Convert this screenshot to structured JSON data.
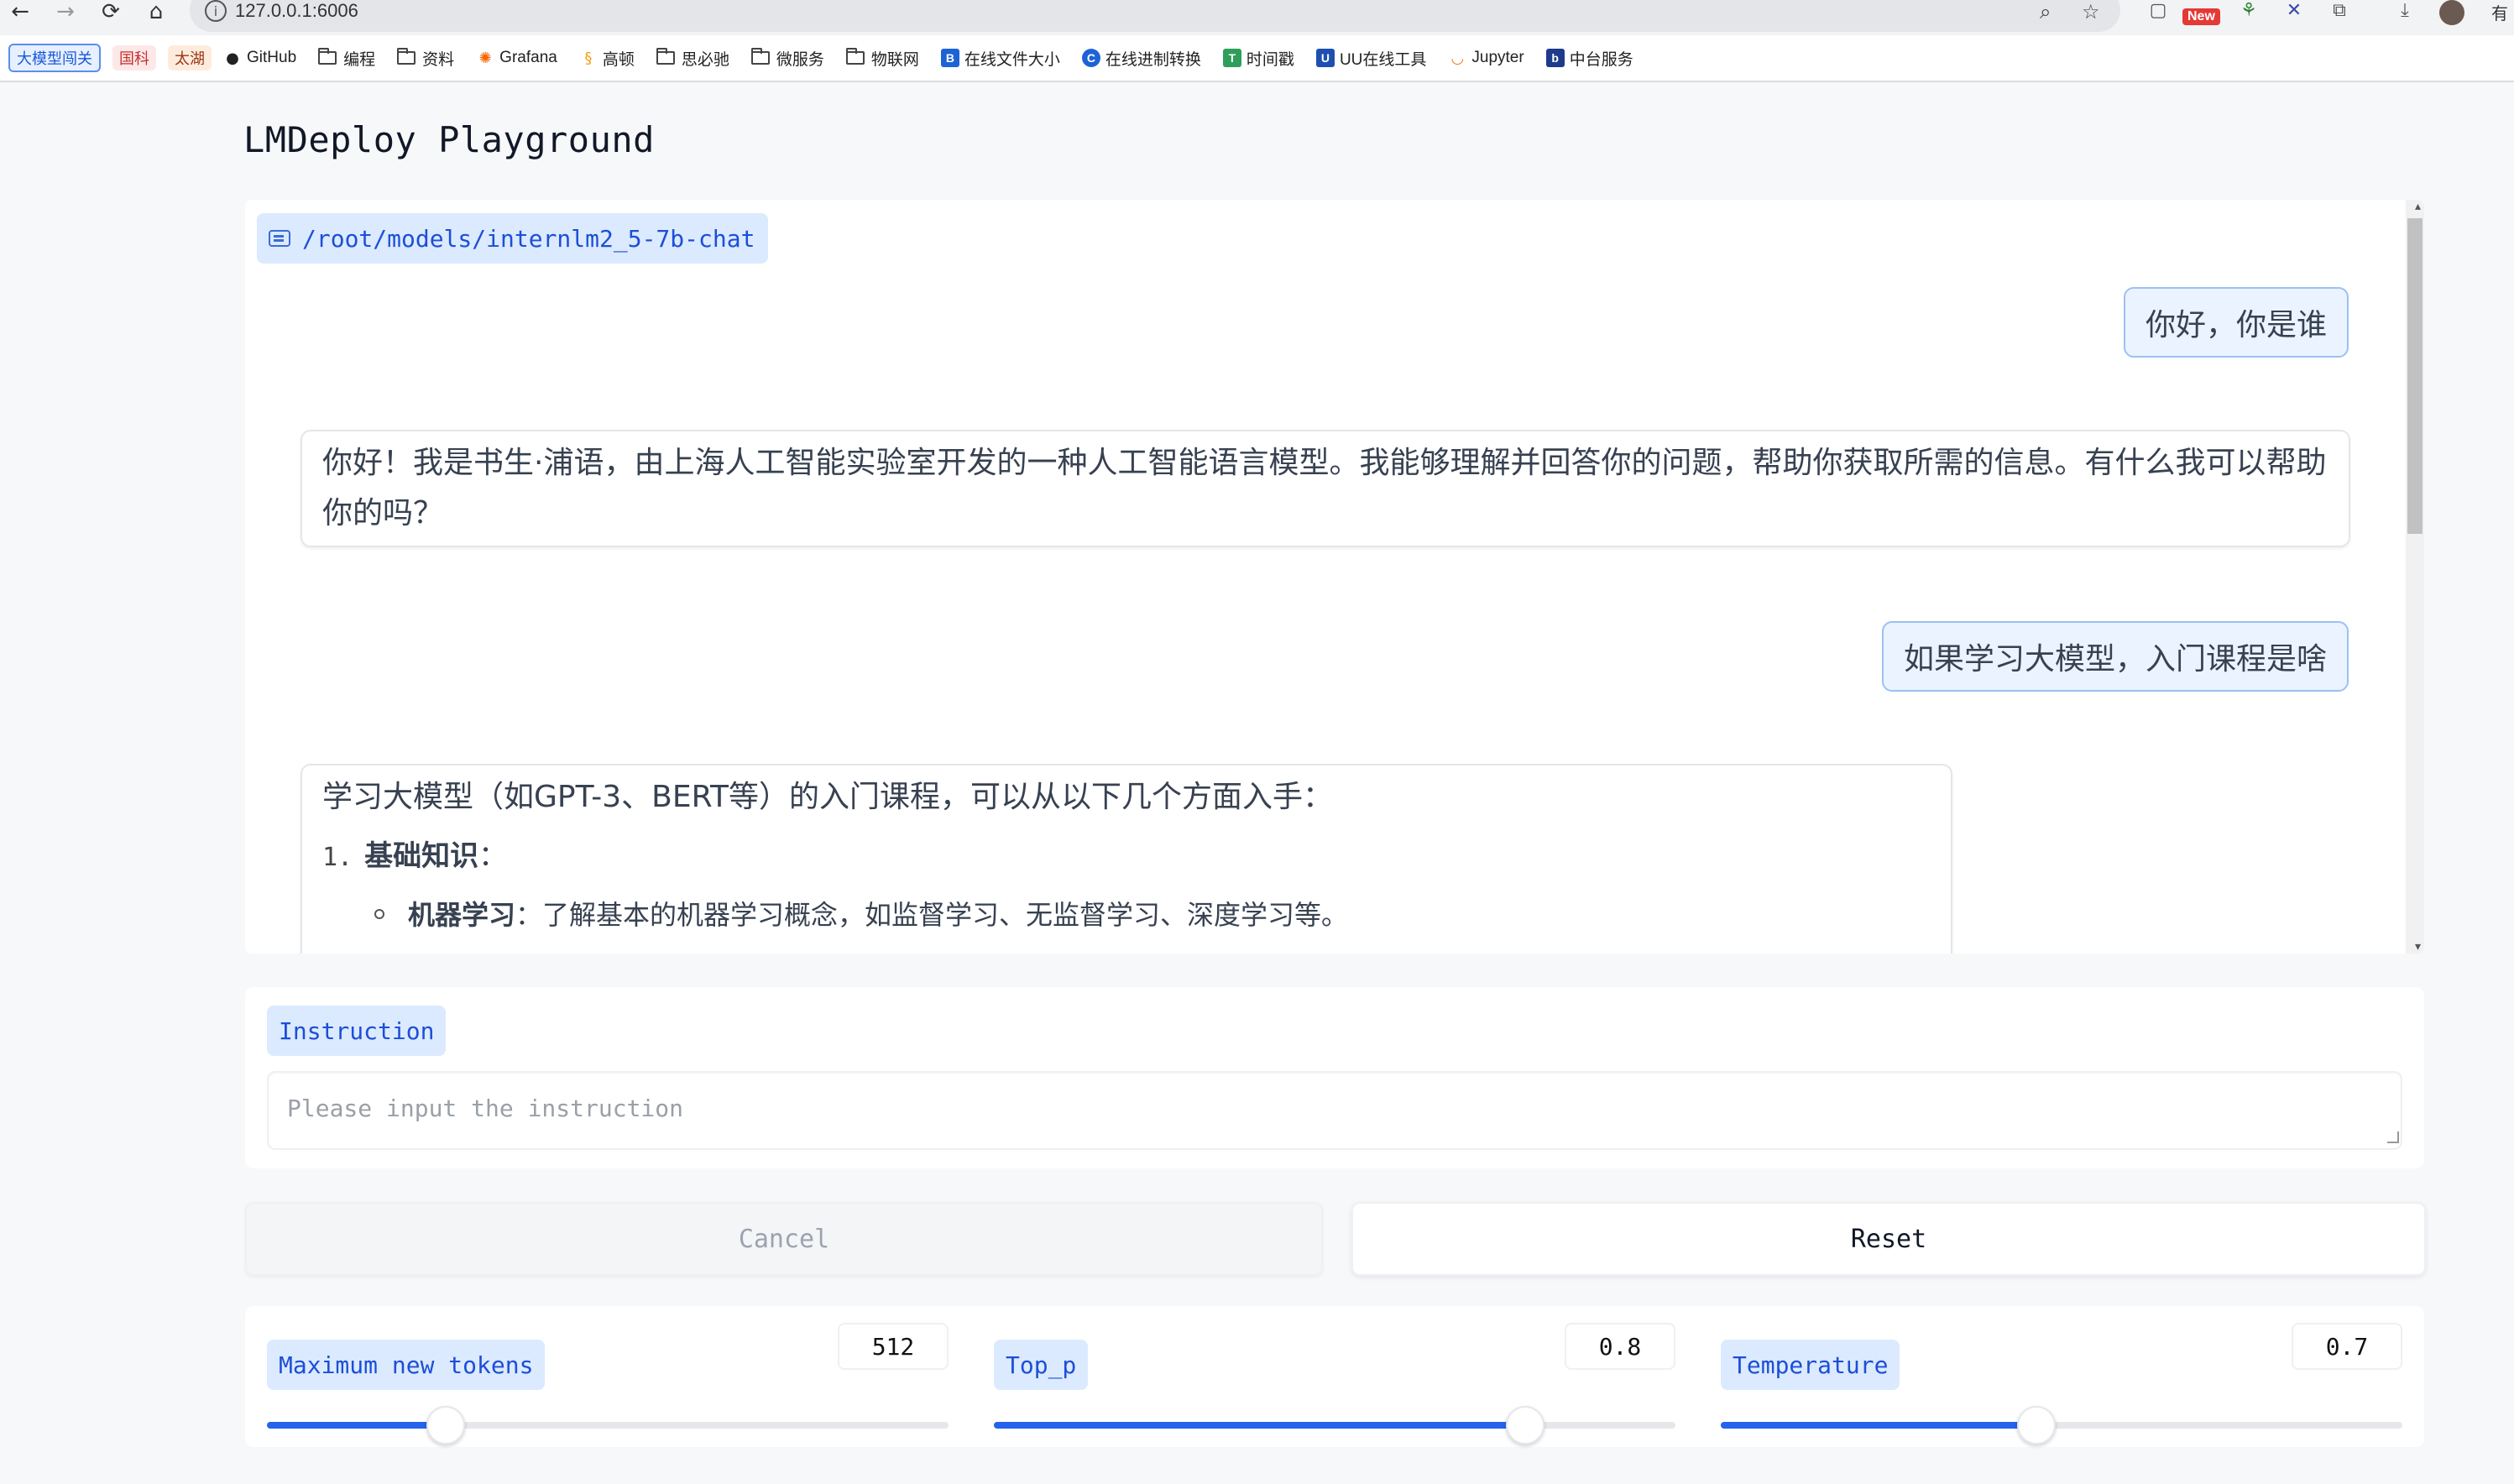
{
  "browser": {
    "url": "127.0.0.1:6006",
    "new_badge": "New",
    "edge_text": "有"
  },
  "bookmarks": {
    "tags": [
      "大模型闯关",
      "国科",
      "太湖"
    ],
    "items": [
      "GitHub",
      "编程",
      "资料",
      "Grafana",
      "高顿",
      "思必驰",
      "微服务",
      "物联网",
      "在线文件大小",
      "在线进制转换",
      "时间戳",
      "UU在线工具",
      "Jupyter",
      "中台服务"
    ]
  },
  "page": {
    "title": "LMDeploy Playground"
  },
  "chat": {
    "model": "/root/models/internlm2_5-7b-chat",
    "messages": [
      {
        "role": "user",
        "text": "你好，你是谁"
      },
      {
        "role": "assistant",
        "text": "你好！我是书生·浦语，由上海人工智能实验室开发的一种人工智能语言模型。我能够理解并回答你的问题，帮助你获取所需的信息。有什么我可以帮助你的吗？"
      },
      {
        "role": "user",
        "text": "如果学习大模型，入门课程是啥"
      },
      {
        "role": "assistant",
        "intro": "学习大模型（如GPT-3、BERT等）的入门课程，可以从以下几个方面入手：",
        "list_num": "1.",
        "list_title": "基础知识",
        "list_colon": "：",
        "sub_title": "机器学习",
        "sub_text": "：了解基本的机器学习概念，如监督学习、无监督学习、深度学习等。"
      }
    ]
  },
  "instruction": {
    "label": "Instruction",
    "placeholder": "Please input the instruction",
    "value": ""
  },
  "buttons": {
    "cancel": "Cancel",
    "reset": "Reset"
  },
  "sliders": [
    {
      "label": "Maximum new tokens",
      "value": "512",
      "fraction": 0.262
    },
    {
      "label": "Top_p",
      "value": "0.8",
      "fraction": 0.78
    },
    {
      "label": "Temperature",
      "value": "0.7",
      "fraction": 0.463
    }
  ],
  "colors": {
    "accent": "#2563eb",
    "chip_bg": "#dbeafe",
    "user_bubble": "#eaf3ff"
  }
}
